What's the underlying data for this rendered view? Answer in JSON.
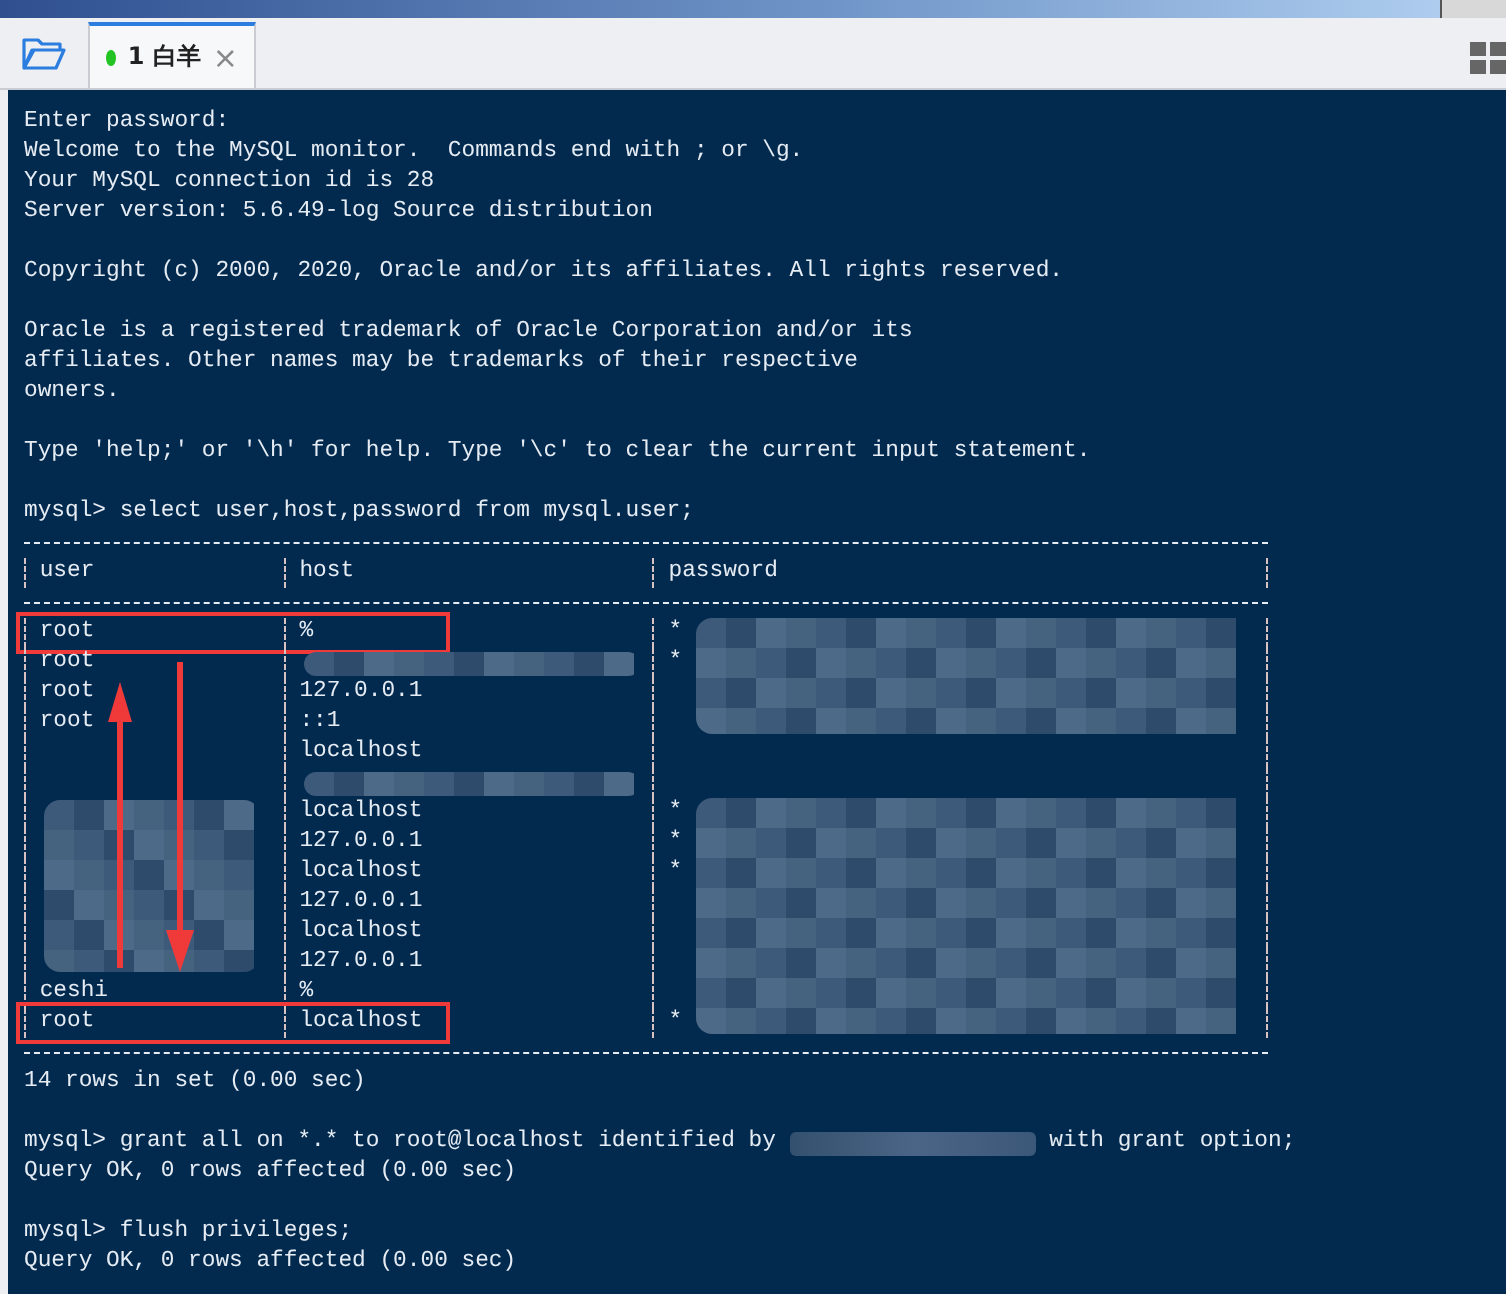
{
  "tab": {
    "number": "1",
    "label": "白羊",
    "selected": true,
    "color": "#22c322",
    "close": "×"
  },
  "terminal": {
    "lines_before": [
      {
        "kind": "text",
        "text": "Enter password:"
      },
      {
        "kind": "text",
        "text": "Welcome to the MySQL monitor.  Commands end with ; or \\g."
      },
      {
        "kind": "text",
        "text": "Your MySQL connection id is 28"
      },
      {
        "kind": "text",
        "text": "Server version: 5.6.49-log Source distribution"
      },
      {
        "kind": "blank"
      },
      {
        "kind": "text",
        "text": "Copyright (c) 2000, 2020, Oracle and/or its affiliates. All rights reserved."
      },
      {
        "kind": "blank"
      },
      {
        "kind": "text",
        "text": "Oracle is a registered trademark of Oracle Corporation and/or its"
      },
      {
        "kind": "text",
        "text": "affiliates. Other names may be trademarks of their respective"
      },
      {
        "kind": "text",
        "text": "owners."
      },
      {
        "kind": "blank"
      },
      {
        "kind": "text",
        "text": "Type 'help;' or '\\h' for help. Type '\\c' to clear the current input statement."
      },
      {
        "kind": "blank"
      },
      {
        "kind": "text",
        "text": "mysql> select user,host,password from mysql.user;"
      }
    ],
    "table": {
      "columns": [
        "user",
        "host",
        "password"
      ],
      "rows": [
        {
          "user": "root",
          "host": "%",
          "password": "*",
          "highlighted": true
        },
        {
          "user": "root",
          "password": "*",
          "highlighted": false
        },
        {
          "user": "root",
          "host": "127.0.0.1",
          "highlighted": false
        },
        {
          "user": "root",
          "host": "::1",
          "highlighted": false
        },
        {
          "host": "localhost",
          "highlighted": false
        },
        {
          "highlighted": false
        },
        {
          "host": "localhost",
          "password": "*",
          "highlighted": false
        },
        {
          "host": "127.0.0.1",
          "password": "*",
          "highlighted": false
        },
        {
          "host": "localhost",
          "password": "*",
          "highlighted": false
        },
        {
          "host": "127.0.0.1",
          "highlighted": false
        },
        {
          "host": "localhost",
          "highlighted": false
        },
        {
          "host": "127.0.0.1",
          "highlighted": false
        },
        {
          "user": "ceshi",
          "host": "%",
          "highlighted": false
        },
        {
          "user": "root",
          "host": "localhost",
          "password": "*",
          "highlighted": true
        }
      ]
    },
    "lines_after": [
      {
        "kind": "text",
        "text": "14 rows in set (0.00 sec)"
      },
      {
        "kind": "blank"
      },
      {
        "kind": "redacted",
        "before": "mysql> grant all on *.* to root@localhost identified by",
        "after": "with grant option;"
      },
      {
        "kind": "text",
        "text": "Query OK, 0 rows affected (0.00 sec)"
      },
      {
        "kind": "blank"
      },
      {
        "kind": "text",
        "text": "mysql> flush privileges;"
      },
      {
        "kind": "text",
        "text": "Query OK, 0 rows affected (0.00 sec)"
      }
    ]
  }
}
